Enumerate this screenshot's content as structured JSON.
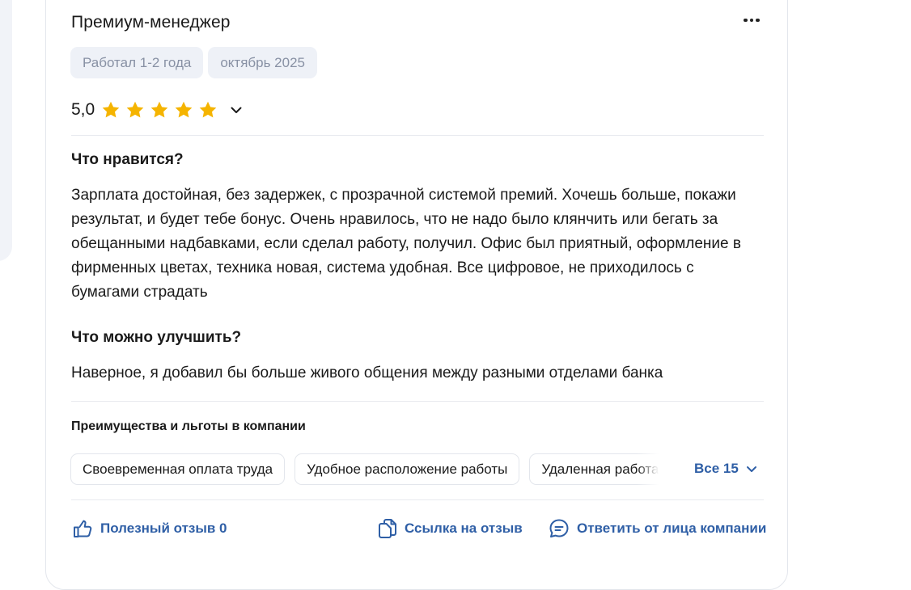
{
  "review": {
    "position": "Премиум-менеджер",
    "tags": [
      "Работал 1-2 года",
      "октябрь 2025"
    ],
    "rating": "5,0",
    "star_count": 5,
    "star_color": "#f5b400",
    "likes_title": "Что нравится?",
    "likes_text": "Зарплата достойная, без задержек, с прозрачной системой премий. Хочешь больше, покажи результат, и будет тебе бонус. Очень нравилось, что не надо было клянчить или бегать за обещанными надбавками, если сделал работу, получил. Офис был приятный, оформление в фирменных цветах, техника новая, система удобная. Все цифровое, не приходилось с бумагами страдать",
    "improve_title": "Что можно улучшить?",
    "improve_text": "Наверное, я добавил бы больше живого общения между разными отделами банка"
  },
  "benefits": {
    "title": "Преимущества и льготы в компании",
    "items": [
      "Своевременная оплата труда",
      "Удобное расположение работы",
      "Удаленная работа"
    ],
    "all_label": "Все 15"
  },
  "actions": {
    "helpful_label": "Полезный отзыв 0",
    "link_label": "Ссылка на отзыв",
    "reply_label": "Ответить от лица компании"
  },
  "icons": {
    "more": "more-horizontal-icon",
    "chevron": "chevron-down-icon",
    "thumb": "thumbs-up-icon",
    "copy": "copy-link-icon",
    "reply": "chat-bubble-icon"
  },
  "colors": {
    "accent": "#2f5fa6",
    "star": "#f5b400",
    "chip_bg": "#eef1f7",
    "chip_text": "#8891a4"
  }
}
